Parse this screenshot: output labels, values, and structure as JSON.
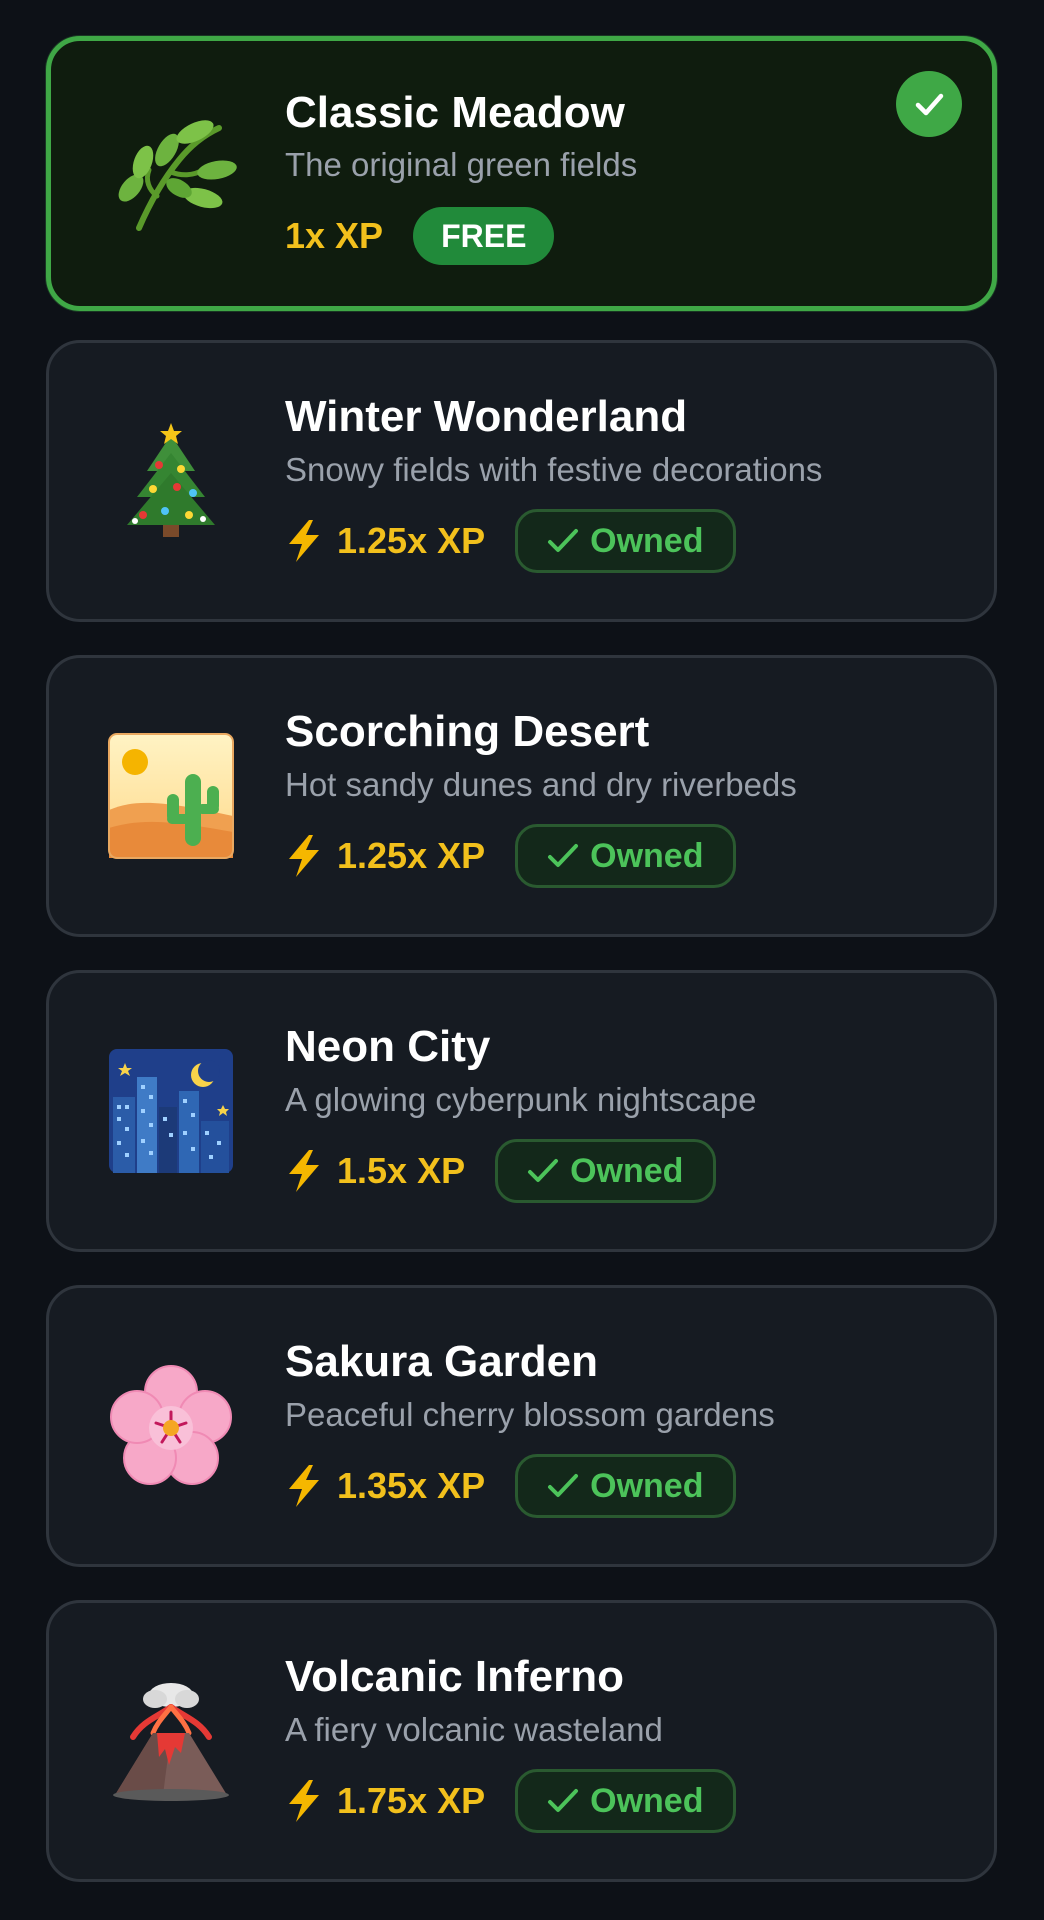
{
  "themes": [
    {
      "title": "Classic Meadow",
      "subtitle": "The original green fields",
      "xp_label": "1x XP",
      "badge_label": "FREE",
      "status": "selected",
      "icon": "herb-icon"
    },
    {
      "title": "Winter Wonderland",
      "subtitle": "Snowy fields with festive decorations",
      "xp_label": "1.25x XP",
      "badge_label": "Owned",
      "status": "owned",
      "icon": "christmas-tree-icon"
    },
    {
      "title": "Scorching Desert",
      "subtitle": "Hot sandy dunes and dry riverbeds",
      "xp_label": "1.25x XP",
      "badge_label": "Owned",
      "status": "owned",
      "icon": "desert-icon"
    },
    {
      "title": "Neon City",
      "subtitle": "A glowing cyberpunk nightscape",
      "xp_label": "1.5x XP",
      "badge_label": "Owned",
      "status": "owned",
      "icon": "night-city-icon"
    },
    {
      "title": "Sakura Garden",
      "subtitle": "Peaceful cherry blossom gardens",
      "xp_label": "1.35x XP",
      "badge_label": "Owned",
      "status": "owned",
      "icon": "cherry-blossom-icon"
    },
    {
      "title": "Volcanic Inferno",
      "subtitle": "A fiery volcanic wasteland",
      "xp_label": "1.75x XP",
      "badge_label": "Owned",
      "status": "owned",
      "icon": "volcano-icon"
    }
  ],
  "colors": {
    "background": "#0d1117",
    "card": "#161b22",
    "selected_card": "#0f1c0e",
    "selected_border": "#3fa846",
    "xp": "#f2c01c",
    "owned_text": "#4cc35a",
    "free_badge": "#218a3a"
  }
}
